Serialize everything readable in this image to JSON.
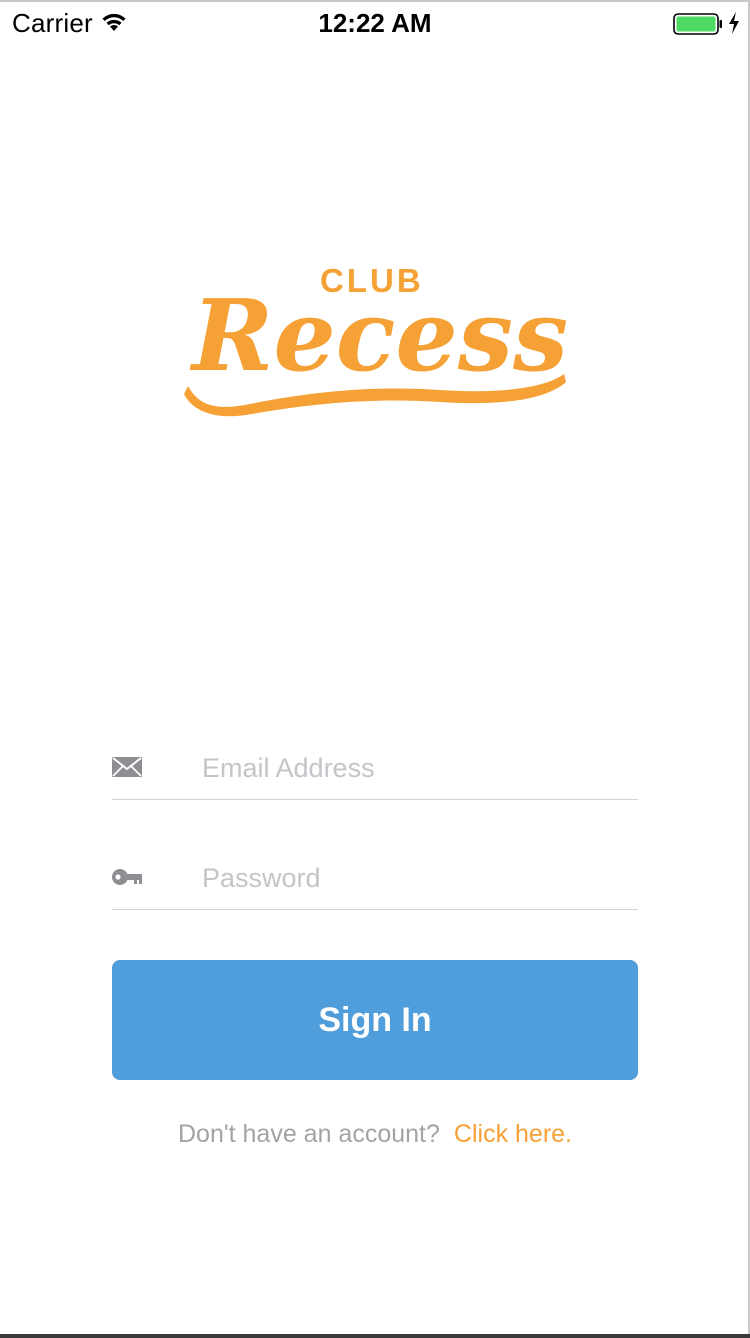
{
  "status_bar": {
    "carrier": "Carrier",
    "time": "12:22 AM",
    "battery_color": "#4cd964"
  },
  "logo": {
    "club_text": "CLUB",
    "recess_text": "Recess",
    "brand_color": "#f6a135"
  },
  "form": {
    "email": {
      "placeholder": "Email Address",
      "value": "",
      "icon": "envelope-icon"
    },
    "password": {
      "placeholder": "Password",
      "value": "",
      "icon": "key-icon"
    },
    "signin_label": "Sign In",
    "signin_color": "#4f9ddb"
  },
  "signup": {
    "prompt": "Don't have an account?",
    "link": "Click here."
  }
}
